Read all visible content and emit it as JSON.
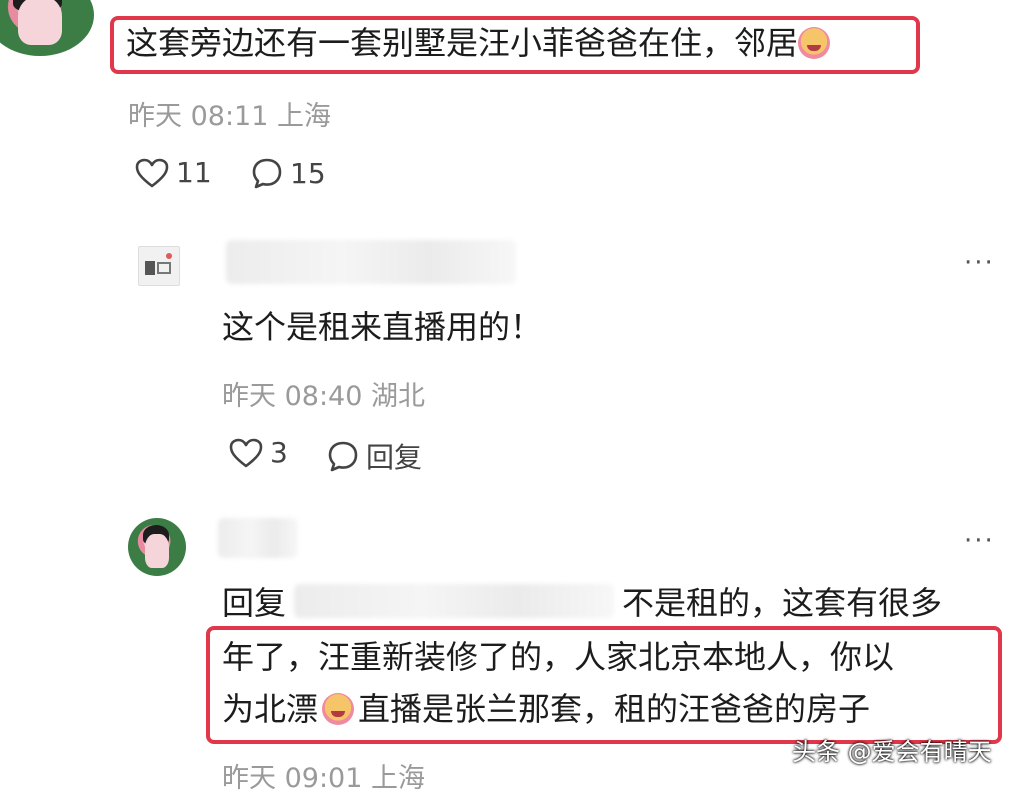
{
  "comment1": {
    "text": "这套旁边还有一套别墅是汪小菲爸爸在住，邻居",
    "emoji": "crying-emoji",
    "meta": "昨天 08:11 上海",
    "likes": "11",
    "replies": "15"
  },
  "reply1": {
    "text": "这个是租来直播用的！",
    "meta": "昨天 08:40 湖北",
    "likes": "3",
    "reply_label": "回复",
    "more": "···"
  },
  "reply2": {
    "prefix": "回复",
    "line1_suffix": "不是租的，这套有很多",
    "line2": "年了，汪重新装修了的，人家北京本地人，你以",
    "line3_a": "为北漂",
    "line3_b": "直播是张兰那套，租的汪爸爸的房子",
    "meta": "昨天 09:01 上海",
    "more": "···"
  },
  "watermark": "头条 @爱会有晴天",
  "colors": {
    "highlight": "#e0384a",
    "meta": "#9a9a9a"
  }
}
